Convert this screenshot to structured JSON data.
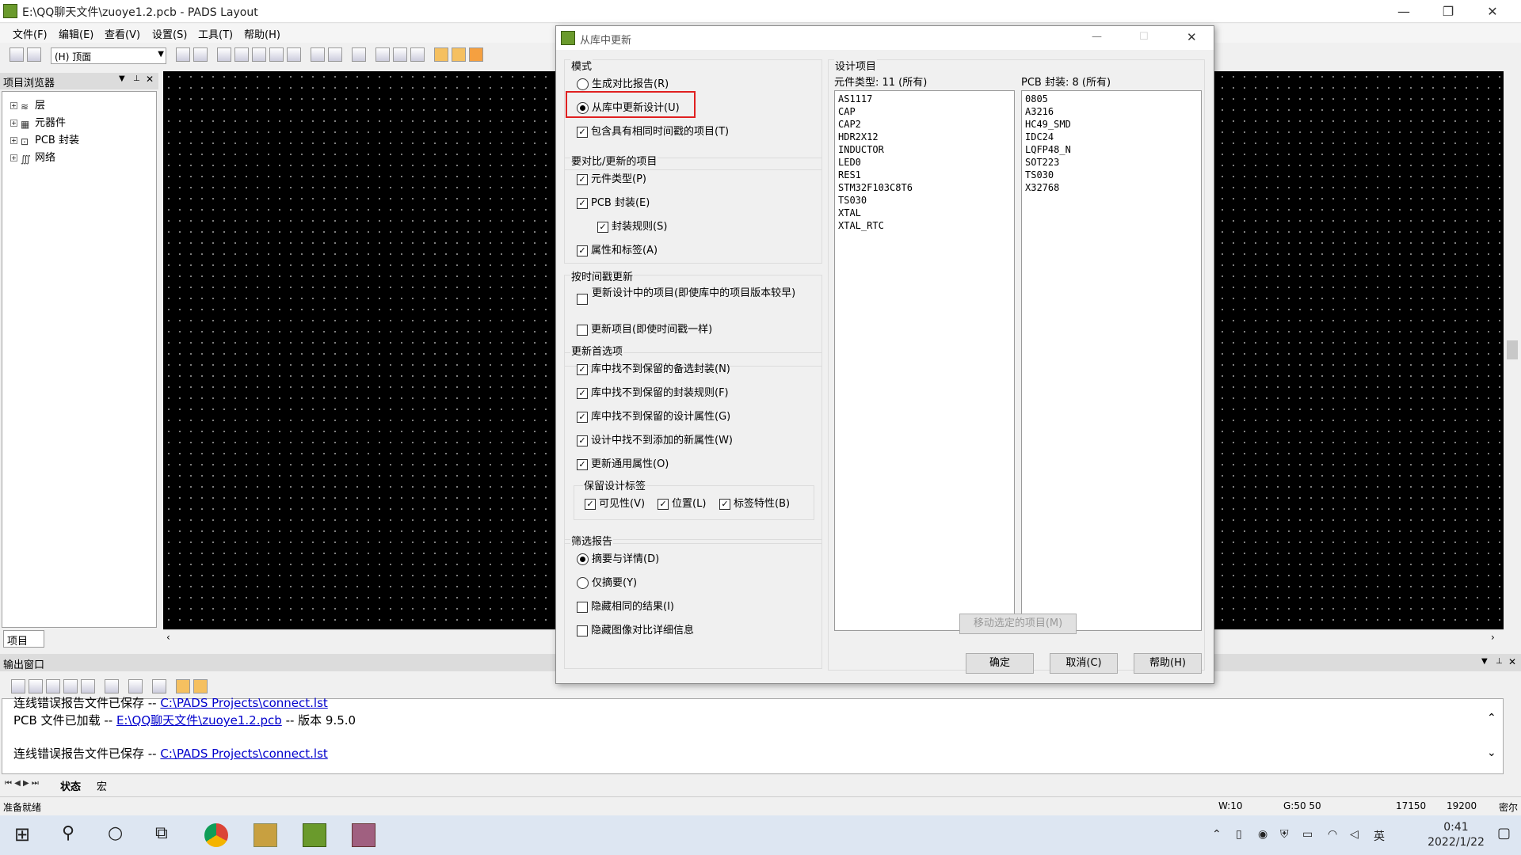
{
  "window": {
    "title": "E:\\QQ聊天文件\\zuoye1.2.pcb - PADS Layout",
    "minimize": "—",
    "restore": "❐",
    "close": "✕"
  },
  "menu": [
    "文件(F)",
    "编辑(E)",
    "查看(V)",
    "设置(S)",
    "工具(T)",
    "帮助(H)"
  ],
  "toolbar": {
    "layer_value": "(H) 顶面"
  },
  "project_browser": {
    "title": "项目浏览器",
    "items": [
      {
        "label": "层",
        "icon": "layers-icon"
      },
      {
        "label": "元器件",
        "icon": "component-icon"
      },
      {
        "label": "PCB 封装",
        "icon": "footprint-icon"
      },
      {
        "label": "网络",
        "icon": "net-icon"
      }
    ],
    "tab": "项目"
  },
  "dialog": {
    "title": "从库中更新",
    "mode": {
      "title": "模式",
      "options": [
        "生成对比报告(R)",
        "从库中更新设计(U)"
      ],
      "selected_index": 1,
      "include_same_timestamp": "包含具有相同时间戳的项目(T)",
      "include_same_timestamp_checked": true
    },
    "compare_items": {
      "title": "要对比/更新的项目",
      "part_types": "元件类型(P)",
      "pcb_decals": "PCB 封装(E)",
      "decal_rules": "封装规则(S)",
      "attributes_labels": "属性和标签(A)"
    },
    "timestamp_update": {
      "title": "按时间戳更新",
      "update_older": "更新设计中的项目(即使库中的项目版本较早)",
      "update_same": "更新项目(即使时间戳一样)"
    },
    "update_prefs": {
      "title": "更新首选项",
      "items": [
        "库中找不到保留的备选封装(N)",
        "库中找不到保留的封装规则(F)",
        "库中找不到保留的设计属性(G)",
        "设计中找不到添加的新属性(W)",
        "更新通用属性(O)"
      ],
      "keep_labels": {
        "title": "保留设计标签",
        "visibility": "可见性(V)",
        "position": "位置(L)",
        "label_props": "标签特性(B)"
      }
    },
    "filter_report": {
      "title": "筛选报告",
      "summary_details": "摘要与详情(D)",
      "summary_only": "仅摘要(Y)",
      "hide_same": "隐藏相同的结果(I)",
      "hide_image_diff": "隐藏图像对比详细信息"
    },
    "design_items": {
      "title": "设计项目",
      "part_types_header": "元件类型: 11 (所有)",
      "decals_header": "PCB 封装: 8 (所有)",
      "part_types": [
        "AS1117",
        "CAP",
        "CAP2",
        "HDR2X12",
        "INDUCTOR",
        "LED0",
        "RES1",
        "STM32F103C8T6",
        "TS030",
        "XTAL",
        "XTAL_RTC"
      ],
      "decals": [
        "0805",
        "A3216",
        "HC49_SMD",
        "IDC24",
        "LQFP48_N",
        "SOT223",
        "TS030",
        "X32768"
      ],
      "move_button": "移动选定的项目(M)"
    },
    "buttons": {
      "ok": "确定",
      "cancel": "取消(C)",
      "help": "帮助(H)"
    }
  },
  "output": {
    "title": "输出窗口",
    "line0_prefix": "连线错误报告文件已保存 -- ",
    "line0_link": "C:\\PADS Projects\\connect.lst",
    "line1_prefix": "PCB 文件已加载 -- ",
    "line1_link": "E:\\QQ聊天文件\\zuoye1.2.pcb",
    "line1_suffix": " -- 版本 9.5.0",
    "line2_prefix": "连线错误报告文件已保存 -- ",
    "line2_link": "C:\\PADS Projects\\connect.lst",
    "tabs": [
      "状态",
      "宏"
    ]
  },
  "status": {
    "ready": "准备就绪",
    "w": "W:10",
    "g": "G:50 50",
    "x": "17150",
    "y": "19200",
    "units": "密尔"
  },
  "taskbar": {
    "time": "0:41",
    "date": "2022/1/22",
    "ime": "英"
  },
  "colors": {
    "selection_box": "#e02020",
    "canvas": "#000000",
    "pad_green": "#22dd22",
    "pad_blue": "#1010cc"
  }
}
